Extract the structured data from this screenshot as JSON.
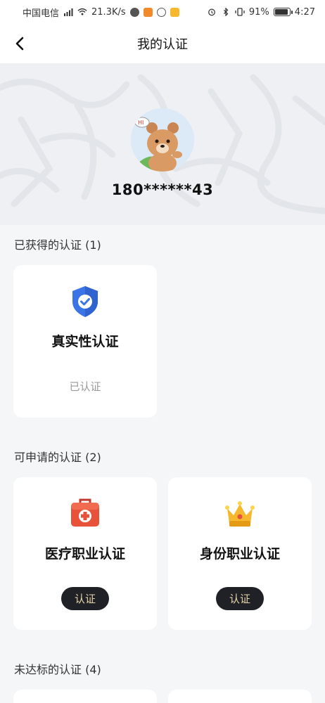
{
  "status_bar": {
    "carrier": "中国电信",
    "speed": "21.3K/s",
    "battery": "91%",
    "time": "4:27"
  },
  "nav": {
    "title": "我的认证"
  },
  "profile": {
    "phone": "180******43"
  },
  "sections": {
    "obtained": "已获得的认证 (1)",
    "available": "可申请的认证 (2)",
    "unmet": "未达标的认证 (4)"
  },
  "cards": {
    "authenticity": {
      "name": "真实性认证",
      "status": "已认证"
    },
    "medical": {
      "name": "医疗职业认证",
      "button": "认证"
    },
    "identity": {
      "name": "身份职业认证",
      "button": "认证"
    }
  },
  "colors": {
    "shield": "#3a74e6",
    "medical": "#e8523a",
    "crown": "#f5b82e",
    "button_bg": "#1f2126",
    "button_text": "#e7d3a8"
  }
}
